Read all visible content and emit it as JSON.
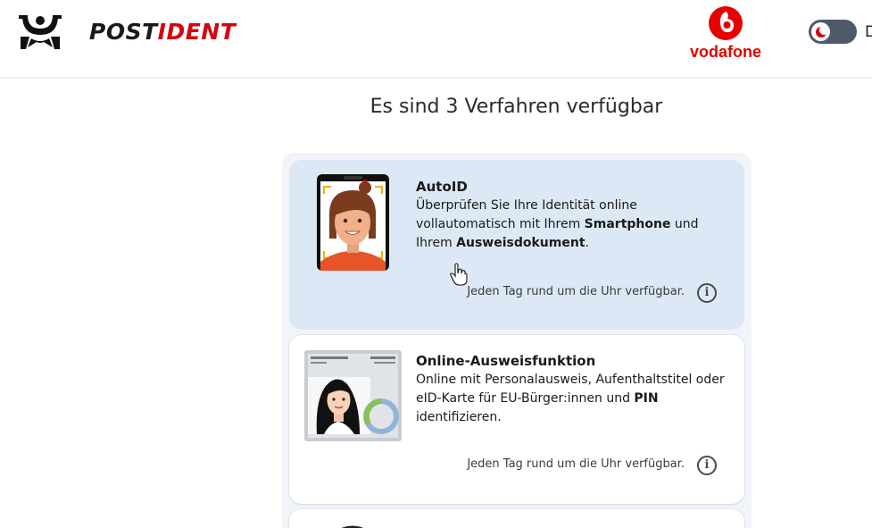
{
  "header": {
    "brand_post": "POST",
    "brand_ident": "IDENT",
    "partner_name": "vodafone",
    "toggle_label": "D"
  },
  "heading": "Es sind 3 Verfahren verfügbar",
  "methods": [
    {
      "title": "AutoID",
      "desc_1": "Überprüfen Sie Ihre Identität online vollautomatisch mit Ihrem ",
      "desc_b1": "Smartphone",
      "desc_2": " und Ihrem ",
      "desc_b2": "Ausweisdokument",
      "desc_3": ".",
      "availability": "Jeden Tag rund um die Uhr verfügbar.",
      "info": "i",
      "selected": true
    },
    {
      "title": "Online-Ausweisfunktion",
      "desc_1": "Online mit Personalausweis, Aufenthaltstitel oder eID-Karte für EU-Bürger:innen und ",
      "desc_b1": "PIN",
      "desc_2": " identifizieren.",
      "availability": "Jeden Tag rund um die Uhr verfügbar.",
      "info": "i",
      "selected": false
    }
  ],
  "colors": {
    "brand_red": "#d40511",
    "vodafone_red": "#e60000",
    "selected_card": "#dde8f6",
    "toggle_bg": "#4e5a6b"
  }
}
